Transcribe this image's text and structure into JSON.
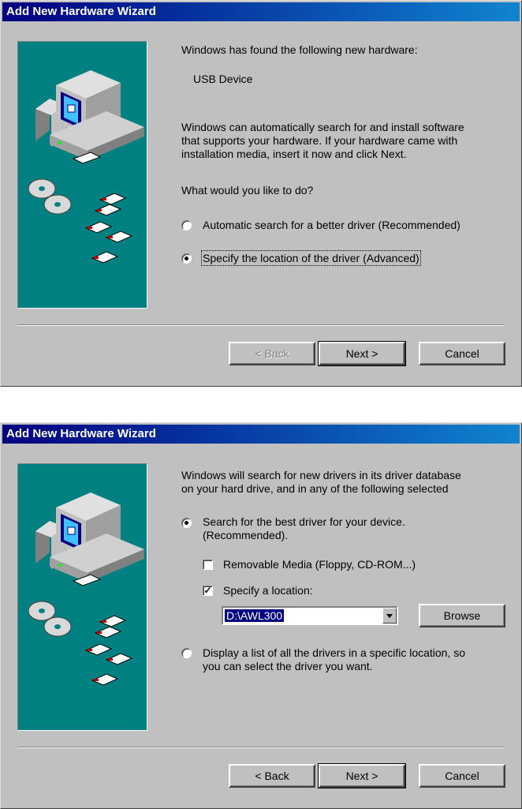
{
  "dialog1": {
    "title": "Add New Hardware Wizard",
    "intro": "Windows has found the following new hardware:",
    "device": "USB Device",
    "para1": "Windows can automatically search for and install software",
    "para2": "that supports your hardware. If your hardware came with",
    "para3": "installation media, insert it now and click Next.",
    "question": "What would you like to do?",
    "option1": "Automatic search for a better driver (Recommended)",
    "option2": "Specify the location of the driver (Advanced)",
    "selected_option": "option2",
    "back": "< Back",
    "next": "Next >",
    "cancel": "Cancel"
  },
  "dialog2": {
    "title": "Add New Hardware Wizard",
    "intro1": "Windows will search for new drivers in its driver database",
    "intro2": "on your hard drive, and in any of the following selected",
    "search_label1": "Search for the best driver for your device.",
    "search_label2": "(Recommended).",
    "removable_media": "Removable Media (Floppy, CD-ROM...)",
    "removable_checked": false,
    "specify_location": "Specify a location:",
    "specify_checked": true,
    "location_value": "D:\\AWL300",
    "browse": "Browse",
    "display_list1": "Display a list of all the drivers in a specific location, so",
    "display_list2": "you can select the driver you want.",
    "selected_option": "search",
    "back": "< Back",
    "next": "Next >",
    "cancel": "Cancel"
  },
  "icons": [
    "computer-icon",
    "cd-icon",
    "floppy-icon",
    "radio-icon",
    "checkbox-icon",
    "dropdown-arrow-icon"
  ]
}
